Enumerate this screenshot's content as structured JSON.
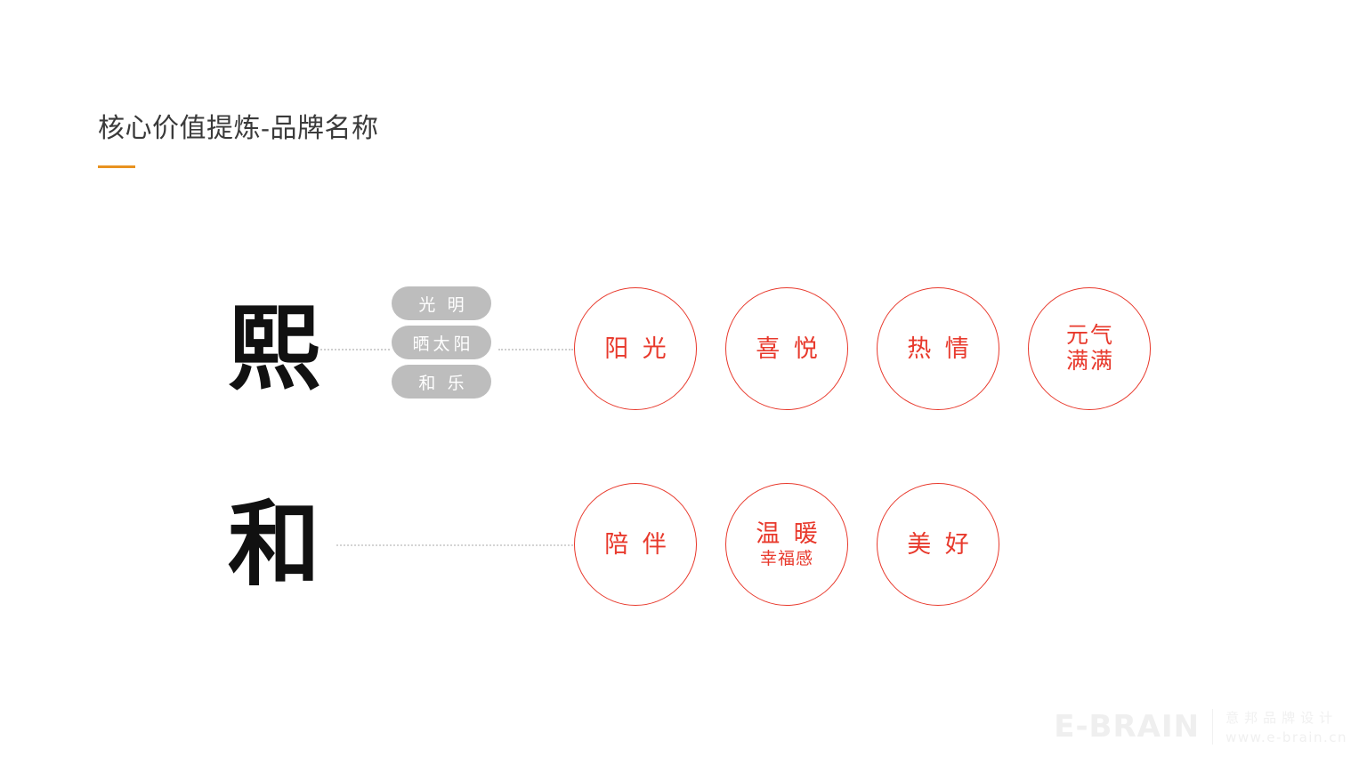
{
  "page": {
    "title": "核心价值提炼-品牌名称",
    "accent_color": "#e8921f",
    "brand_red": "#e8392c",
    "pill_gray": "#bdbdbd",
    "background": "#ffffff"
  },
  "rows": [
    {
      "id": "row-xi",
      "character": "熙",
      "pills": [
        {
          "label": "光 明"
        },
        {
          "label": "晒太阳"
        },
        {
          "label": "和 乐"
        }
      ],
      "circles": [
        {
          "main": "阳 光",
          "sub": ""
        },
        {
          "main": "喜 悦",
          "sub": ""
        },
        {
          "main": "热 情",
          "sub": ""
        },
        {
          "main": "元气",
          "sub": "满满",
          "stacked": true
        }
      ]
    },
    {
      "id": "row-he",
      "character": "和",
      "pills": [],
      "circles": [
        {
          "main": "陪 伴",
          "sub": ""
        },
        {
          "main": "温 暖",
          "sub": "幸福感"
        },
        {
          "main": "美 好",
          "sub": ""
        }
      ]
    }
  ],
  "watermark": {
    "brand": "E-BRAIN",
    "company": "意邦品牌设计",
    "url": "www.e-brain.cn"
  }
}
